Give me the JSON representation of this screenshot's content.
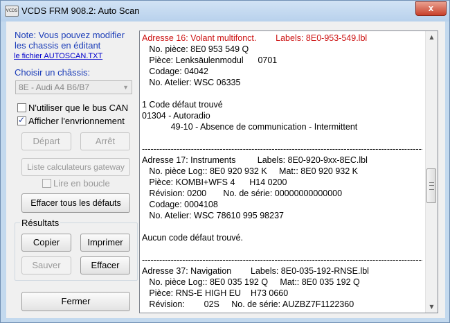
{
  "window": {
    "title": "VCDS FRM 908.2:  Auto Scan",
    "icon_label": "VCDS",
    "close_glyph": "x"
  },
  "left_panel": {
    "note_lines": [
      "Note:  Vous pouvez modifier",
      "les chassis en éditant"
    ],
    "note_link": "le fichier AUTOSCAN.TXT",
    "choose_label": "Choisir un châssis:",
    "chassis_selected": "8E - Audi A4 B6/B7",
    "chk_can_only": {
      "label": "N'utiliser que le bus CAN",
      "checked": false
    },
    "chk_show_env": {
      "label": "Afficher l'envrionnement",
      "checked": true
    },
    "btn_depart": "Départ",
    "btn_arret": "Arrêt",
    "btn_gateway": "Liste calculateurs gateway",
    "chk_loop": {
      "label": "Lire en boucle",
      "checked": false
    },
    "btn_clear_all": "Effacer tous les défauts",
    "results_label": "Résultats",
    "btn_copier": "Copier",
    "btn_imprimer": "Imprimer",
    "btn_sauver": "Sauver",
    "btn_effacer": "Effacer",
    "btn_fermer": "Fermer"
  },
  "log": {
    "lines": [
      {
        "text": "Adresse 16: Volant multifonct.        Labels: 8E0-953-549.lbl",
        "red": true
      },
      {
        "text": "   No. pièce: 8E0 953 549 Q"
      },
      {
        "text": "   Pièce: Lenksäulenmodul      0701"
      },
      {
        "text": "   Codage: 04042"
      },
      {
        "text": "   No. Atelier: WSC 06335"
      },
      {
        "text": ""
      },
      {
        "text": "1 Code défaut trouvé"
      },
      {
        "text": "01304 - Autoradio"
      },
      {
        "text": "            49-10 - Absence de communication - Intermittent"
      },
      {
        "text": ""
      },
      {
        "text": "-------------------------------------------------------------------------------------------------------"
      },
      {
        "text": "Adresse 17: Instruments         Labels: 8E0-920-9xx-8EC.lbl"
      },
      {
        "text": "   No. pièce Log:: 8E0 920 932 K     Mat:: 8E0 920 932 K"
      },
      {
        "text": "   Pièce: KOMBI+WFS 4      H14 0200"
      },
      {
        "text": "   Révision: 0200       No. de série: 00000000000000"
      },
      {
        "text": "   Codage: 0004108"
      },
      {
        "text": "   No. Atelier: WSC 78610 995 98237"
      },
      {
        "text": ""
      },
      {
        "text": "Aucun code défaut trouvé."
      },
      {
        "text": ""
      },
      {
        "text": "-------------------------------------------------------------------------------------------------------"
      },
      {
        "text": "Adresse 37: Navigation        Labels: 8E0-035-192-RNSE.lbl"
      },
      {
        "text": "   No. pièce Log:: 8E0 035 192 Q     Mat:: 8E0 035 192 Q"
      },
      {
        "text": "   Pièce: RNS-E HIGH EU    H73 0660"
      },
      {
        "text": "   Révision:        02S     No. de série: AUZBZ7F1122360"
      }
    ]
  },
  "scrollbar": {
    "up_glyph": "▲",
    "down_glyph": "▼"
  }
}
